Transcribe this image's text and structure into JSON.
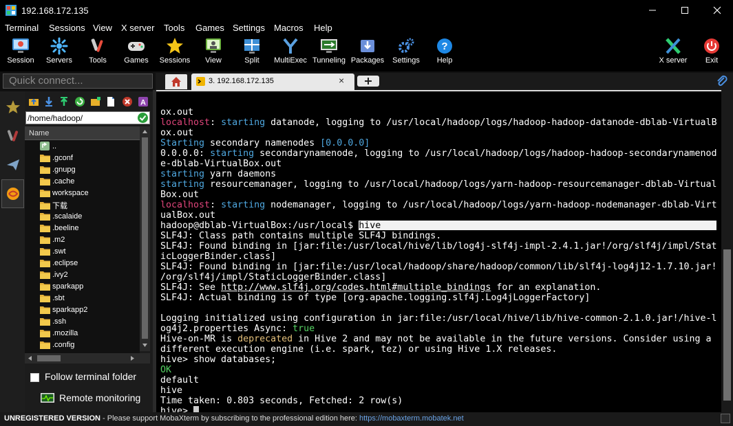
{
  "window": {
    "title": "192.168.172.135",
    "controls": [
      "minimize-icon",
      "maximize-icon",
      "close-icon"
    ]
  },
  "menu": [
    "Terminal",
    "Sessions",
    "View",
    "X server",
    "Tools",
    "Games",
    "Settings",
    "Macros",
    "Help"
  ],
  "toolbar": {
    "session": "Session",
    "servers": "Servers",
    "tools": "Tools",
    "games": "Games",
    "sessions": "Sessions",
    "view": "View",
    "split": "Split",
    "multiexec": "MultiExec",
    "tunneling": "Tunneling",
    "packages": "Packages",
    "settings": "Settings",
    "help": "Help",
    "xserver": "X server",
    "exit": "Exit"
  },
  "quick_connect": "Quick connect...",
  "tabs": {
    "active_label": "3. 192.168.172.135",
    "close": "×"
  },
  "sftp": {
    "path": "/home/hadoop/",
    "column_name": "Name",
    "items": [
      "..",
      ".gconf",
      ".gnupg",
      ".cache",
      "workspace",
      "下载",
      ".scalaide",
      ".beeline",
      ".m2",
      ".swt",
      ".eclipse",
      ".ivy2",
      "sparkapp",
      ".sbt",
      "sparkapp2",
      ".ssh",
      ".mozilla",
      ".config"
    ],
    "follow_label": "Follow terminal folder",
    "remote_label": "Remote monitoring"
  },
  "terminal": {
    "l01": "ox.out",
    "l02a": "localhost",
    "l02b": ": ",
    "l02c": "starting",
    "l02d": " datanode, logging to /usr/local/hadoop/logs/hadoop-hadoop-datanode-dblab-VirtualB",
    "l03": "ox.out",
    "l04a": "Starting",
    "l04b": " secondary namenodes ",
    "l04c": "[0.0.0.0]",
    "l05a": "0.0.0.0: ",
    "l05b": "starting",
    "l05c": " secondarynamenode, logging to /usr/local/hadoop/logs/hadoop-hadoop-secondarynamenod",
    "l06": "e-dblab-VirtualBox.out",
    "l07a": "starting",
    "l07b": " yarn daemons",
    "l08a": "starting",
    "l08b": " resourcemanager, logging to /usr/local/hadoop/logs/yarn-hadoop-resourcemanager-dblab-Virtual",
    "l09": "Box.out",
    "l10a": "localhost",
    "l10b": ": ",
    "l10c": "starting",
    "l10d": " nodemanager, logging to /usr/local/hadoop/logs/yarn-hadoop-nodemanager-dblab-Virt",
    "l11": "ualBox.out",
    "l12a": "hadoop@dblab-VirtualBox:/usr/local$ ",
    "l12b": "hive",
    "l13": "SLF4J: Class path contains multiple SLF4J bindings.",
    "l14": "SLF4J: Found binding in [jar:file:/usr/local/hive/lib/log4j-slf4j-impl-2.4.1.jar!/org/slf4j/impl/Stat",
    "l15": "icLoggerBinder.class]",
    "l16": "SLF4J: Found binding in [jar:file:/usr/local/hadoop/share/hadoop/common/lib/slf4j-log4j12-1.7.10.jar!",
    "l17": "/org/slf4j/impl/StaticLoggerBinder.class]",
    "l18a": "SLF4J: See ",
    "l18b": "http://www.slf4j.org/codes.html#multiple_bindings",
    "l18c": " for an explanation.",
    "l19": "SLF4J: Actual binding is of type [org.apache.logging.slf4j.Log4jLoggerFactory]",
    "l20": "",
    "l21": "Logging initialized using configuration in jar:file:/usr/local/hive/lib/hive-common-2.1.0.jar!/hive-l",
    "l22a": "og4j2.properties Async: ",
    "l22b": "true",
    "l23a": "Hive-on-MR is ",
    "l23b": "deprecated",
    "l23c": " in Hive 2 and may not be available in the future versions. Consider using a",
    "l24": "different execution engine (i.e. spark, tez) or using Hive 1.X releases.",
    "l25": "hive> show databases;",
    "l26": "OK",
    "l27": "default",
    "l28": "hive",
    "l29": "Time taken: 0.803 seconds, Fetched: 2 row(s)",
    "l30": "hive> "
  },
  "status": {
    "bold": "UNREGISTERED VERSION",
    "text": "  -  Please support MobaXterm by subscribing to the professional edition here:  ",
    "link": "https://mobaxterm.mobatek.net"
  },
  "colors": {
    "red": "#e0457b",
    "blue": "#4fa8e0",
    "green": "#56d364",
    "yellow": "#e5c07b"
  }
}
